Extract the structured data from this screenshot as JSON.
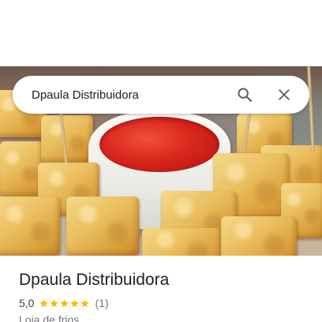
{
  "search": {
    "value": "Dpaula Distribuidora"
  },
  "place": {
    "name": "Dpaula Distribuidora",
    "rating": "5,0",
    "stars_filled": 5,
    "stars_total": 5,
    "review_count": "(1)",
    "category": "Loja de frios"
  },
  "colors": {
    "star": "#fbbc04",
    "icon": "#5f6368"
  },
  "icons": {
    "search": "search-icon",
    "close": "close-icon",
    "star": "star-icon"
  }
}
